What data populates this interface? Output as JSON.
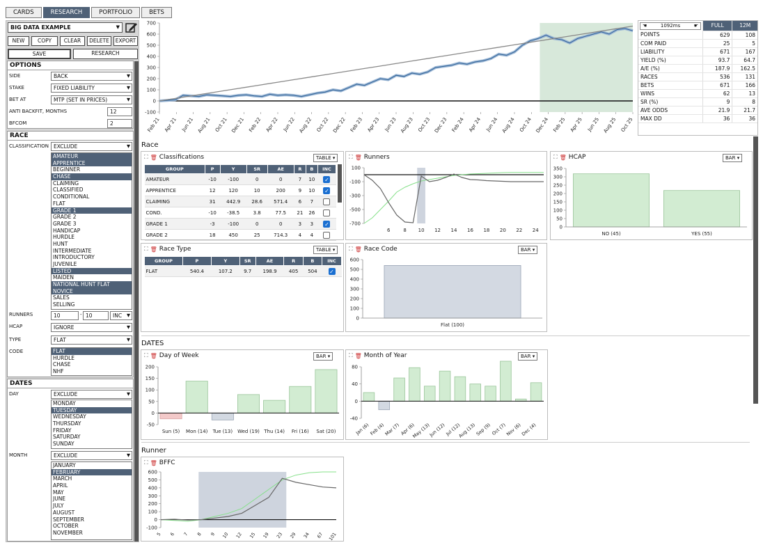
{
  "tabs": [
    "CARDS",
    "RESEARCH",
    "PORTFOLIO",
    "BETS"
  ],
  "system": {
    "name": "BIG DATA EXAMPLE"
  },
  "buttons": {
    "new": "NEW",
    "copy": "COPY",
    "clear": "CLEAR",
    "delete": "DELETE",
    "export": "EXPORT",
    "save": "SAVE",
    "research": "RESEARCH"
  },
  "options": {
    "title": "OPTIONS",
    "side_label": "SIDE",
    "side": "BACK",
    "stake_label": "STAKE",
    "stake": "FIXED LIABILITY",
    "betat_label": "BET AT",
    "betat": "MTP (SET IN PRICES)",
    "antibackfit_label": "ANTI BACKFIT, MONTHS",
    "antibackfit": "12",
    "bfcom_label": "BFCOM",
    "bfcom": "2"
  },
  "race": {
    "title": "RACE",
    "classification_label": "CLASSIFICATION",
    "classification_mode": "EXCLUDE",
    "classifications": [
      {
        "t": "AMATEUR",
        "s": true
      },
      {
        "t": "APPRENTICE",
        "s": true
      },
      {
        "t": "BEGINNER",
        "s": false
      },
      {
        "t": "CHASE",
        "s": true
      },
      {
        "t": "CLAIMING",
        "s": false
      },
      {
        "t": "CLASSIFIED",
        "s": false
      },
      {
        "t": "CONDITIONAL",
        "s": false
      },
      {
        "t": "FLAT",
        "s": false
      },
      {
        "t": "GRADE 1",
        "s": true
      },
      {
        "t": "GRADE 2",
        "s": false
      },
      {
        "t": "GRADE 3",
        "s": false
      },
      {
        "t": "HANDICAP",
        "s": false
      },
      {
        "t": "HURDLE",
        "s": false
      },
      {
        "t": "HUNT",
        "s": false
      },
      {
        "t": "INTERMEDIATE",
        "s": false
      },
      {
        "t": "INTRODUCTORY",
        "s": false
      },
      {
        "t": "JUVENILE",
        "s": false
      },
      {
        "t": "LISTED",
        "s": true
      },
      {
        "t": "MAIDEN",
        "s": false
      },
      {
        "t": "NATIONAL HUNT FLAT",
        "s": true
      },
      {
        "t": "NOVICE",
        "s": true
      },
      {
        "t": "SALES",
        "s": false
      },
      {
        "t": "SELLING",
        "s": false
      }
    ],
    "runners_label": "RUNNERS",
    "runners_min": "10",
    "runners_max": "10",
    "runners_mode": "INC",
    "hcap_label": "HCAP",
    "hcap": "IGNORE",
    "type_label": "TYPE",
    "type": "FLAT",
    "code_label": "CODE",
    "codes": [
      {
        "t": "FLAT",
        "s": true
      },
      {
        "t": "HURDLE",
        "s": false
      },
      {
        "t": "CHASE",
        "s": false
      },
      {
        "t": "NHF",
        "s": false
      }
    ]
  },
  "dates": {
    "title": "DATES",
    "day_label": "DAY",
    "day_mode": "EXCLUDE",
    "days": [
      {
        "t": "MONDAY",
        "s": false
      },
      {
        "t": "TUESDAY",
        "s": true
      },
      {
        "t": "WEDNESDAY",
        "s": false
      },
      {
        "t": "THURSDAY",
        "s": false
      },
      {
        "t": "FRIDAY",
        "s": false
      },
      {
        "t": "SATURDAY",
        "s": false
      },
      {
        "t": "SUNDAY",
        "s": false
      }
    ],
    "month_label": "MONTH",
    "month_mode": "EXCLUDE",
    "months": [
      {
        "t": "JANUARY",
        "s": false
      },
      {
        "t": "FEBRUARY",
        "s": true
      },
      {
        "t": "MARCH",
        "s": false
      },
      {
        "t": "APRIL",
        "s": false
      },
      {
        "t": "MAY",
        "s": false
      },
      {
        "t": "JUNE",
        "s": false
      },
      {
        "t": "JULY",
        "s": false
      },
      {
        "t": "AUGUST",
        "s": false
      },
      {
        "t": "SEPTEMBER",
        "s": false
      },
      {
        "t": "OCTOBER",
        "s": false
      },
      {
        "t": "NOVEMBER",
        "s": false
      }
    ]
  },
  "stats": {
    "timing": "1092ms",
    "col_full": "FULL",
    "col_12m": "12M",
    "rows": [
      [
        "POINTS",
        "629",
        "108"
      ],
      [
        "COM PAID",
        "25",
        "5"
      ],
      [
        "LIABILITY",
        "671",
        "167"
      ],
      [
        "YIELD (%)",
        "93.7",
        "64.7"
      ],
      [
        "A/E (%)",
        "187.9",
        "162.5"
      ],
      [
        "RACES",
        "536",
        "131"
      ],
      [
        "BETS",
        "671",
        "166"
      ],
      [
        "WINS",
        "62",
        "13"
      ],
      [
        "SR (%)",
        "9",
        "8"
      ],
      [
        "AVE ODDS",
        "21.9",
        "21.7"
      ],
      [
        "MAX DD",
        "36",
        "36"
      ]
    ]
  },
  "sections": {
    "race": "Race",
    "dates": "DATES",
    "runner": "Runner"
  },
  "panels": {
    "classifications": {
      "title": "Classifications",
      "mode": "TABLE",
      "headers": [
        "GROUP",
        "P",
        "Y",
        "SR",
        "AE",
        "R",
        "B",
        "INC"
      ],
      "rows": [
        [
          "AMATEUR",
          "-10",
          "-100",
          "0",
          "0",
          "7",
          "10",
          true
        ],
        [
          "APPRENTICE",
          "12",
          "120",
          "10",
          "200",
          "9",
          "10",
          true
        ],
        [
          "CLAIMING",
          "31",
          "442.9",
          "28.6",
          "571.4",
          "6",
          "7",
          false
        ],
        [
          "COND.",
          "-10",
          "-38.5",
          "3.8",
          "77.5",
          "21",
          "26",
          false
        ],
        [
          "GRADE 1",
          "-3",
          "-100",
          "0",
          "0",
          "3",
          "3",
          true
        ],
        [
          "GRADE 2",
          "18",
          "450",
          "25",
          "714.3",
          "4",
          "4",
          false
        ]
      ]
    },
    "race_type": {
      "title": "Race Type",
      "mode": "TABLE",
      "headers": [
        "GROUP",
        "P",
        "Y",
        "SR",
        "AE",
        "R",
        "B",
        "INC"
      ],
      "rows": [
        [
          "FLAT",
          "540.4",
          "107.2",
          "9.7",
          "198.9",
          "405",
          "504",
          true
        ]
      ]
    },
    "runners": {
      "title": "Runners"
    },
    "hcap": {
      "title": "HCAP",
      "mode": "BAR"
    },
    "race_code": {
      "title": "Race Code",
      "mode": "BAR"
    },
    "dow": {
      "title": "Day of Week",
      "mode": "BAR"
    },
    "moy": {
      "title": "Month of Year",
      "mode": "BAR"
    },
    "bffc": {
      "title": "BFFC"
    }
  },
  "chart_data": [
    {
      "id": "equity",
      "type": "line",
      "x_ticks": [
        "Feb 21",
        "Apr 21",
        "Jun 21",
        "Aug 21",
        "Oct 21",
        "Dec 21",
        "Feb 22",
        "Apr 22",
        "Jun 22",
        "Aug 22",
        "Oct 22",
        "Dec 22",
        "Feb 23",
        "Apr 23",
        "Jun 23",
        "Aug 23",
        "Oct 23",
        "Dec 23",
        "Feb 24",
        "Apr 24",
        "Jun 24",
        "Aug 24",
        "Oct 24",
        "Dec 24",
        "Feb 25",
        "Apr 25",
        "Jun 25",
        "Aug 25",
        "Oct 25"
      ],
      "ylim": [
        -100,
        700
      ],
      "y_ticks": [
        -100,
        0,
        100,
        200,
        300,
        400,
        500,
        600,
        700
      ],
      "shaded_from": "Sep 24",
      "series": [
        {
          "values": [
            0,
            5,
            10,
            50,
            45,
            40,
            55,
            50,
            45,
            40,
            50,
            55,
            45,
            40,
            60,
            50,
            55,
            50,
            40,
            55,
            70,
            80,
            100,
            90,
            120,
            150,
            140,
            170,
            200,
            190,
            230,
            220,
            250,
            240,
            260,
            300,
            310,
            320,
            340,
            330,
            350,
            360,
            380,
            420,
            410,
            440,
            500,
            540,
            560,
            590,
            560,
            550,
            520,
            560,
            580,
            600,
            620,
            600,
            640,
            650,
            630
          ]
        },
        {
          "values": [
            0,
            24,
            48,
            72,
            96,
            120,
            144,
            168,
            192,
            216,
            240,
            264,
            288,
            312,
            336,
            360,
            384,
            408,
            432,
            456,
            480,
            504,
            528,
            552,
            576,
            600,
            624,
            648,
            672
          ]
        }
      ]
    },
    {
      "id": "runners",
      "type": "line",
      "x_ticks": [
        6,
        8,
        10,
        12,
        14,
        16,
        18,
        20,
        22,
        24
      ],
      "ylim": [
        -700,
        100
      ],
      "y_ticks": [
        100,
        -100,
        -300,
        -500,
        -700
      ],
      "series": [
        {
          "x": [
            3,
            4,
            5,
            6,
            7,
            8,
            9,
            10,
            11,
            12,
            13,
            14,
            15,
            16,
            17,
            18,
            19,
            20,
            21,
            22,
            23,
            24,
            25
          ],
          "values": [
            0,
            -80,
            -200,
            -400,
            -580,
            -680,
            -690,
            -20,
            -100,
            -80,
            -40,
            10,
            -40,
            -70,
            -75,
            -85,
            -90,
            -95,
            -100,
            -100,
            -100,
            -100,
            -100
          ]
        },
        {
          "x": [
            3,
            4,
            5,
            6,
            7,
            8,
            9,
            10,
            11,
            12,
            13,
            14,
            15,
            16,
            17,
            18,
            19,
            20,
            21,
            22,
            23,
            24,
            25
          ],
          "values": [
            -700,
            -620,
            -500,
            -380,
            -250,
            -180,
            -130,
            -90,
            -70,
            -50,
            -30,
            -10,
            0,
            10,
            15,
            20,
            25,
            30,
            32,
            32,
            33,
            33,
            33
          ]
        }
      ]
    },
    {
      "id": "hcap",
      "type": "bar",
      "categories": [
        "NO (45)",
        "YES (55)"
      ],
      "values": [
        318,
        218
      ],
      "ylim": [
        0,
        350
      ],
      "y_ticks": [
        0,
        50,
        100,
        150,
        200,
        250,
        300,
        350
      ]
    },
    {
      "id": "race_code",
      "type": "bar",
      "categories": [
        "Flat (100)"
      ],
      "values": [
        540
      ],
      "ylim": [
        0,
        600
      ],
      "y_ticks": [
        0,
        100,
        200,
        300,
        400,
        500,
        600
      ]
    },
    {
      "id": "dow",
      "type": "bar",
      "categories": [
        "Sun (5)",
        "Mon (14)",
        "Tue (13)",
        "Wed (19)",
        "Thu (14)",
        "Fri (16)",
        "Sat (20)"
      ],
      "values": [
        -25,
        138,
        -30,
        80,
        55,
        115,
        188
      ],
      "ylim": [
        -50,
        200
      ],
      "y_ticks": [
        -50,
        0,
        50,
        100,
        150,
        200
      ]
    },
    {
      "id": "moy",
      "type": "bar",
      "categories": [
        "Jan (6)",
        "Feb (4)",
        "Mar (7)",
        "Apr (6)",
        "May (13)",
        "Jun (12)",
        "Jul (12)",
        "Aug (13)",
        "Sep (9)",
        "Oct (7)",
        "Nov (6)",
        "Dec (4)"
      ],
      "values": [
        20,
        -20,
        54,
        78,
        35,
        70,
        57,
        40,
        35,
        93,
        5,
        43
      ],
      "ylim": [
        -40,
        80
      ],
      "y_ticks": [
        -40,
        0,
        40,
        80
      ]
    },
    {
      "id": "bffc",
      "type": "line",
      "x_ticks": [
        "5",
        "6",
        "7",
        "8",
        "9",
        "10",
        "12",
        "15",
        "19",
        "23",
        "29",
        "34",
        "67",
        "101"
      ],
      "ylim": [
        -100,
        600
      ],
      "y_ticks": [
        -100,
        0,
        100,
        200,
        300,
        400,
        500,
        600
      ],
      "series": [
        {
          "values": [
            0,
            5,
            -5,
            0,
            20,
            40,
            80,
            180,
            280,
            520,
            470,
            440,
            410,
            400
          ]
        },
        {
          "values": [
            0,
            -10,
            -20,
            0,
            40,
            80,
            140,
            260,
            380,
            500,
            560,
            590,
            600,
            600
          ]
        }
      ]
    }
  ]
}
